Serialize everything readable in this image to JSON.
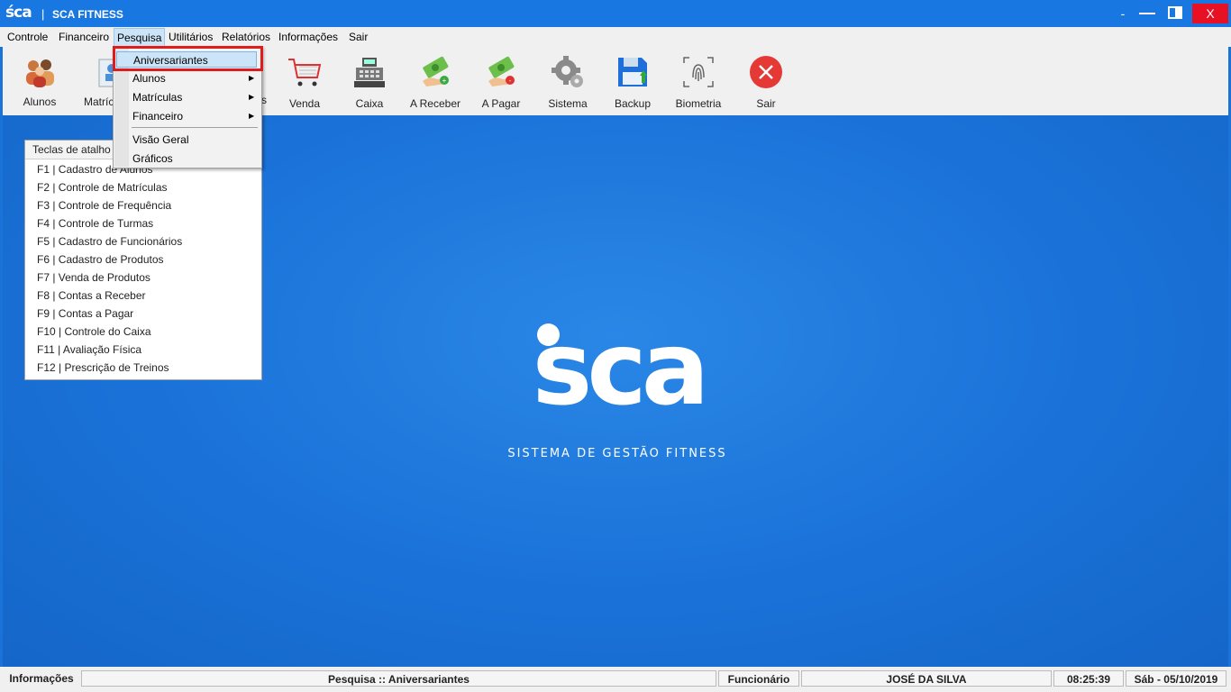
{
  "window": {
    "logo": "śca",
    "separator": "|",
    "title": "SCA FITNESS",
    "minimize_label": "-",
    "close_label": "X"
  },
  "menubar": {
    "items": [
      "Controle",
      "Financeiro",
      "Pesquisa",
      "Utilitários",
      "Relatórios",
      "Informações",
      "Sair"
    ],
    "active": "Pesquisa"
  },
  "toolbar": {
    "items": [
      "Alunos",
      "Matríc",
      "s",
      "Venda",
      "Caixa",
      "A Receber",
      "A Pagar",
      "Sistema",
      "Backup",
      "Biometria",
      "Sair"
    ]
  },
  "dropdown": {
    "items": [
      "Aniversariantes",
      "Alunos",
      "Matrículas",
      "Financeiro",
      "Visão Geral",
      "Gráficos"
    ],
    "submenu_arrow": "▶",
    "highlighted": "Aniversariantes"
  },
  "shortcuts": {
    "header": "Teclas de atalho",
    "items": [
      "F1 | Cadastro de Alunos",
      "F2 | Controle de Matrículas",
      "F3 | Controle de Frequência",
      "F4 | Controle de Turmas",
      "F5 | Cadastro de Funcionários",
      "F6 | Cadastro de Produtos",
      "F7 | Venda de Produtos",
      "F8 | Contas a Receber",
      "F9 | Contas a Pagar",
      "F10 | Controle do Caixa",
      "F11 | Avaliação Física",
      "F12 | Prescrição de Treinos"
    ]
  },
  "logo": {
    "word": "sca",
    "subtitle": "SISTEMA DE GESTÃO FITNESS"
  },
  "statusbar": {
    "info_label": "Informações",
    "action": "Pesquisa :: Aniversariantes",
    "role": "Funcionário",
    "user": "JOSÉ DA SILVA",
    "time": "08:25:39",
    "date": "Sáb - 05/10/2019"
  },
  "colors": {
    "accent": "#1877e0",
    "close": "#e81123",
    "highlight_box": "#e01b1b",
    "sair_icon": "#e53935"
  }
}
